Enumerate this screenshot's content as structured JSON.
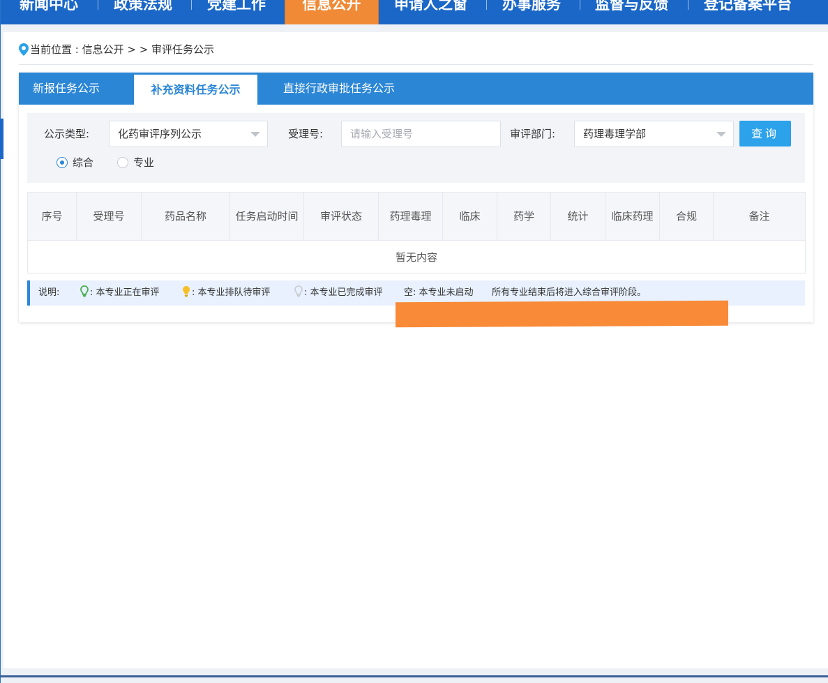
{
  "nav": {
    "items": [
      {
        "label": "新闻中心"
      },
      {
        "label": "政策法规"
      },
      {
        "label": "党建工作"
      },
      {
        "label": "信息公开",
        "active": true
      },
      {
        "label": "申请人之窗"
      },
      {
        "label": "办事服务"
      },
      {
        "label": "监督与反馈"
      },
      {
        "label": "登记备案平台"
      }
    ],
    "active_color": "#f08a36",
    "bar_color": "#1a67c7"
  },
  "breadcrumb": {
    "prefix": "当前位置 : 信息公开 ",
    "separator": "> >",
    "current": "审评任务公示"
  },
  "tabs": [
    {
      "label": "新报任务公示"
    },
    {
      "label": "补充资料任务公示",
      "active": true
    },
    {
      "label": "直接行政审批任务公示"
    }
  ],
  "filter": {
    "type_label": "公示类型:",
    "type_value": "化药审评序列公示",
    "accept_label": "受理号:",
    "accept_placeholder": "请输入受理号",
    "dept_label": "审评部门:",
    "dept_value": "药理毒理学部",
    "query_label": "查询",
    "radios": [
      {
        "label": "综合",
        "checked": true
      },
      {
        "label": "专业",
        "checked": false
      }
    ]
  },
  "table": {
    "headers": [
      "序号",
      "受理号",
      "药品名称",
      "任务启动时间",
      "审评状态",
      "药理毒理",
      "临床",
      "药学",
      "统计",
      "临床药理",
      "合规",
      "备注"
    ],
    "empty_text": "暂无内容"
  },
  "legend": {
    "label": "说明:",
    "green": "本专业正在审评",
    "yellow": "本专业排队待审评",
    "grey": "本专业已完成审评",
    "empty": "空: 本专业未启动",
    "note": "所有专业结束后将进入综合审评阶段。",
    "colors": {
      "green": "#4caf50",
      "yellow": "#f5c026",
      "grey": "#c8ccd2"
    }
  },
  "accent_color": "#2b86d6"
}
